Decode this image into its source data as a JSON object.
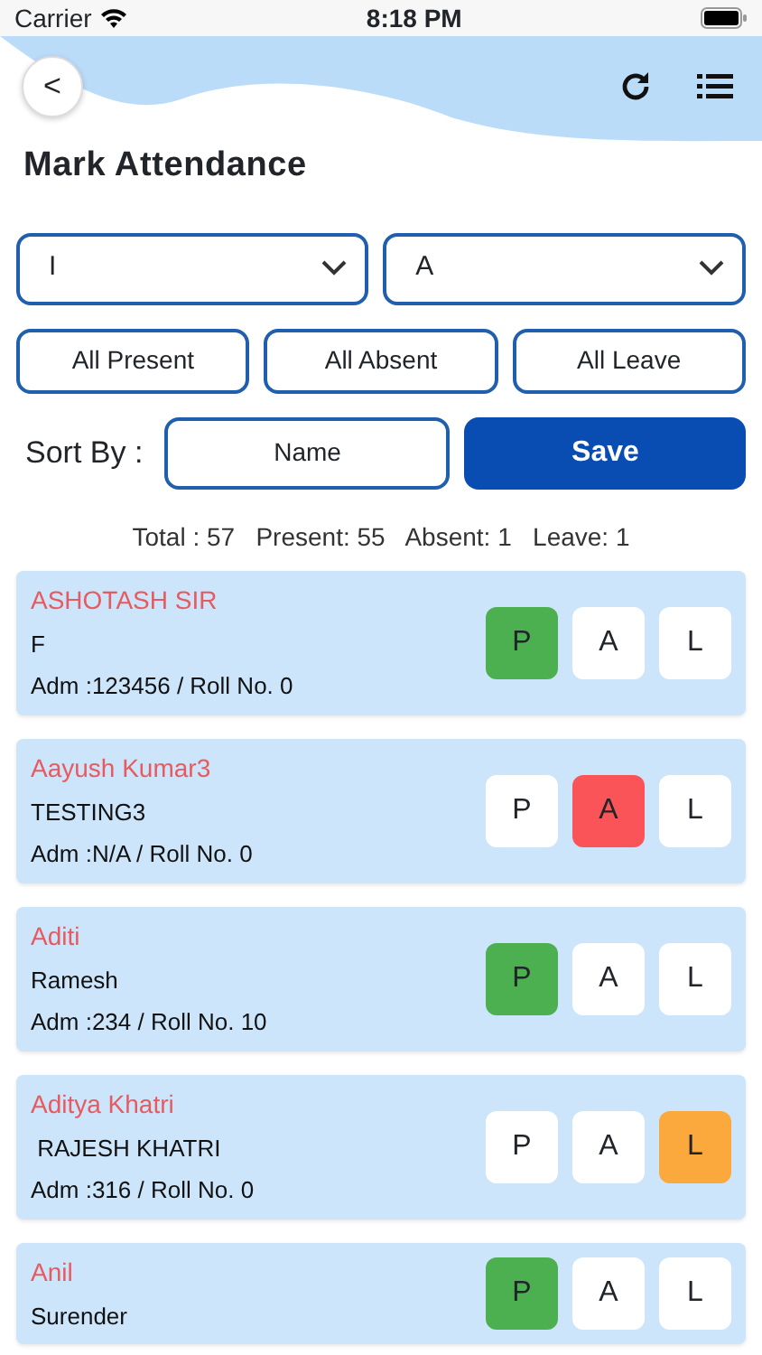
{
  "status_bar": {
    "carrier": "Carrier",
    "time": "8:18 PM"
  },
  "header": {
    "back": "<",
    "title": "Mark Attendance"
  },
  "filters": [
    {
      "value": "I"
    },
    {
      "value": "A"
    }
  ],
  "bulk_buttons": [
    "All Present",
    "All Absent",
    "All Leave"
  ],
  "sort": {
    "label": "Sort By :",
    "value": "Name",
    "save": "Save"
  },
  "summary": "Total : 57   Present: 55   Absent: 1   Leave: 1",
  "students": [
    {
      "name": "ASHOTASH SIR",
      "parent": "F",
      "adm": "Adm :123456 / Roll No. 0",
      "marks": [
        {
          "label": "P",
          "selected": true
        },
        {
          "label": "A",
          "selected": false
        },
        {
          "label": "L",
          "selected": false
        }
      ]
    },
    {
      "name": "Aayush Kumar3",
      "parent": "TESTING3",
      "adm": "Adm :N/A / Roll No. 0",
      "marks": [
        {
          "label": "P",
          "selected": false
        },
        {
          "label": "A",
          "selected": true
        },
        {
          "label": "L",
          "selected": false
        }
      ]
    },
    {
      "name": "Aditi",
      "parent": "Ramesh",
      "adm": "Adm :234 / Roll No. 10",
      "marks": [
        {
          "label": "P",
          "selected": true
        },
        {
          "label": "A",
          "selected": false
        },
        {
          "label": "L",
          "selected": false
        }
      ]
    },
    {
      "name": "Aditya Khatri",
      "parent": " RAJESH KHATRI",
      "adm": "Adm :316 / Roll No. 0",
      "marks": [
        {
          "label": "P",
          "selected": false
        },
        {
          "label": "A",
          "selected": false
        },
        {
          "label": "L",
          "selected": true
        }
      ]
    },
    {
      "name": "Anil",
      "parent": "Surender",
      "marks": [
        {
          "label": "P",
          "selected": true
        },
        {
          "label": "A",
          "selected": false
        },
        {
          "label": "L",
          "selected": false
        }
      ]
    }
  ]
}
